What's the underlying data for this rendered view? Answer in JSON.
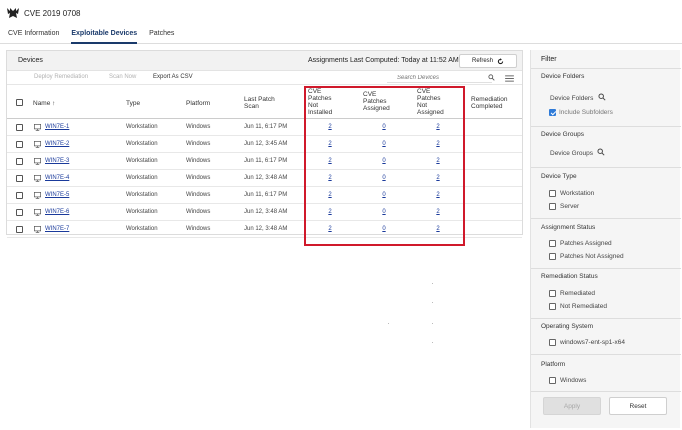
{
  "app": {
    "title": "CVE 2019 0708"
  },
  "tabs": [
    {
      "label": "CVE Information",
      "active": false
    },
    {
      "label": "Exploitable Devices",
      "active": true
    },
    {
      "label": "Patches",
      "active": false
    }
  ],
  "devices": {
    "title": "Devices",
    "assignments_label": "Assignments Last Computed: Today at 11:52 AM",
    "refresh_label": "Refresh",
    "toolbar": {
      "deploy_label": "Deploy Remediation",
      "scan_label": "Scan Now",
      "export_label": "Export As CSV",
      "search_placeholder": "Search Devices"
    },
    "columns": {
      "name": "Name ↑",
      "type": "Type",
      "platform": "Platform",
      "last_scan": [
        "Last Patch",
        "Scan"
      ],
      "not_installed": [
        "CVE",
        "Patches",
        "Not",
        "Installed"
      ],
      "assigned": [
        "CVE",
        "Patches",
        "Assigned"
      ],
      "not_assigned": [
        "CVE",
        "Patches",
        "Not",
        "Assigned"
      ],
      "remediation": [
        "Remediation",
        "Completed"
      ]
    },
    "rows": [
      {
        "name": "WIN7E-1",
        "type": "Workstation",
        "platform": "Windows",
        "last_scan": "Jun 11, 6:17 PM",
        "not_installed": "2",
        "assigned": "0",
        "not_assigned": "2"
      },
      {
        "name": "WIN7E-2",
        "type": "Workstation",
        "platform": "Windows",
        "last_scan": "Jun 12, 3:45 AM",
        "not_installed": "2",
        "assigned": "0",
        "not_assigned": "2"
      },
      {
        "name": "WIN7E-3",
        "type": "Workstation",
        "platform": "Windows",
        "last_scan": "Jun 11, 6:17 PM",
        "not_installed": "2",
        "assigned": "0",
        "not_assigned": "2"
      },
      {
        "name": "WIN7E-4",
        "type": "Workstation",
        "platform": "Windows",
        "last_scan": "Jun 12, 3:48 AM",
        "not_installed": "2",
        "assigned": "0",
        "not_assigned": "2"
      },
      {
        "name": "WIN7E-5",
        "type": "Workstation",
        "platform": "Windows",
        "last_scan": "Jun 11, 6:17 PM",
        "not_installed": "2",
        "assigned": "0",
        "not_assigned": "2"
      },
      {
        "name": "WIN7E-6",
        "type": "Workstation",
        "platform": "Windows",
        "last_scan": "Jun 12, 3:48 AM",
        "not_installed": "2",
        "assigned": "0",
        "not_assigned": "2"
      },
      {
        "name": "WIN7E-7",
        "type": "Workstation",
        "platform": "Windows",
        "last_scan": "Jun 12, 3:48 AM",
        "not_installed": "2",
        "assigned": "0",
        "not_assigned": "2"
      }
    ],
    "highlight_color": "#d0192b"
  },
  "filter": {
    "title": "Filter",
    "device_folders": {
      "title": "Device Folders",
      "button": "Device Folders",
      "include_subfolders": "Include Subfolders",
      "include_checked": true
    },
    "device_groups": {
      "title": "Device Groups",
      "button": "Device Groups"
    },
    "device_type": {
      "title": "Device Type",
      "options": [
        "Workstation",
        "Server"
      ]
    },
    "assignment_status": {
      "title": "Assignment Status",
      "options": [
        "Patches Assigned",
        "Patches Not Assigned"
      ]
    },
    "remediation_status": {
      "title": "Remediation Status",
      "options": [
        "Remediated",
        "Not Remediated"
      ]
    },
    "operating_system": {
      "title": "Operating System",
      "options": [
        "windows7-ent-sp1-x64"
      ]
    },
    "platform": {
      "title": "Platform",
      "options": [
        "Windows"
      ]
    },
    "apply_label": "Apply",
    "reset_label": "Reset"
  }
}
